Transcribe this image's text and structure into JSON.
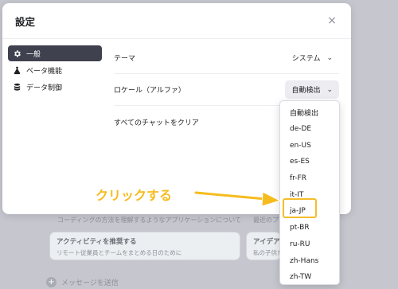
{
  "background": {
    "faint_line_left": "コーディングの方法を理解するようなアプリケーションについて",
    "faint_line_right": "最近のプロジェクト",
    "cards": [
      {
        "title": "アクティビティを推奨する",
        "sub": "リモート従業員とチームをまとめる日のために"
      },
      {
        "title": "アイデアを",
        "sub": "私の子供たち"
      }
    ],
    "input_placeholder": "メッセージを送信",
    "input_plus": "+"
  },
  "dialog": {
    "title": "設定",
    "close": "×"
  },
  "sidebar": {
    "items": [
      {
        "label": "一般",
        "icon": "gear-icon",
        "active": true
      },
      {
        "label": "ベータ機能",
        "icon": "flask-icon",
        "active": false
      },
      {
        "label": "データ制御",
        "icon": "database-icon",
        "active": false
      }
    ]
  },
  "settings": {
    "theme_label": "テーマ",
    "theme_value": "システム",
    "locale_label": "ロケール（アルファ）",
    "locale_value": "自動検出",
    "clear_label": "すべてのチャットをクリア"
  },
  "dropdown": {
    "options": [
      "自動検出",
      "de-DE",
      "en-US",
      "es-ES",
      "fr-FR",
      "it-IT",
      "ja-JP",
      "pt-BR",
      "ru-RU",
      "zh-Hans",
      "zh-TW"
    ],
    "highlighted": "ja-JP"
  },
  "annotation": {
    "text": "クリックする",
    "color": "#f6bc1e"
  },
  "colors": {
    "active_sidebar": "#40414f",
    "highlight": "#f4bd2a"
  }
}
